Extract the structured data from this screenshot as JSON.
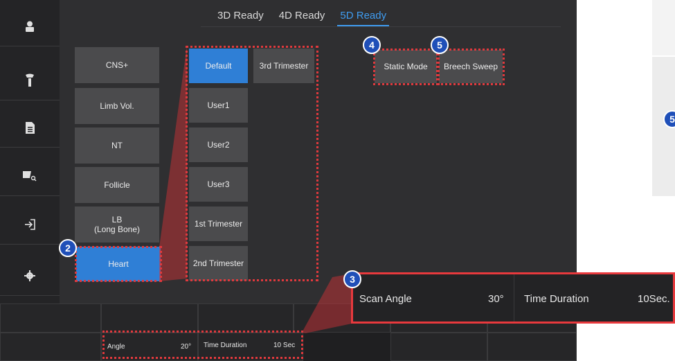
{
  "sidebar": {
    "items": [
      {
        "icon": "user-icon"
      },
      {
        "icon": "probe-icon"
      },
      {
        "icon": "document-icon"
      },
      {
        "icon": "image-search-icon"
      },
      {
        "icon": "exit-icon"
      },
      {
        "icon": "settings-icon"
      }
    ]
  },
  "tabs": [
    "3D Ready",
    "4D Ready",
    "5D Ready"
  ],
  "active_tab": "5D Ready",
  "left_buttons": [
    "CNS+",
    "Limb Vol.",
    "NT",
    "Follicle",
    "LB\n(Long Bone)",
    "Heart"
  ],
  "presets": [
    "Default",
    "3rd Trimester",
    "User1",
    "User2",
    "User3",
    "1st Trimester",
    "2nd Trimester"
  ],
  "mode_buttons": [
    "Static Mode",
    "Breech Sweep"
  ],
  "badges": {
    "two": "2",
    "three": "3",
    "four": "4",
    "five": "5",
    "side_five": "5"
  },
  "bottom_bar": {
    "angle_label": "Angle",
    "angle_value": "20°",
    "time_label": "Time Duration",
    "time_value": "10 Sec"
  },
  "zoom": {
    "scan_angle_label": "Scan Angle",
    "scan_angle_value": "30°",
    "time_label": "Time Duration",
    "time_value": "10Sec."
  },
  "colors": {
    "accent": "#2f7fd6",
    "highlight": "#e0393d",
    "badge": "#1f4fb8"
  }
}
